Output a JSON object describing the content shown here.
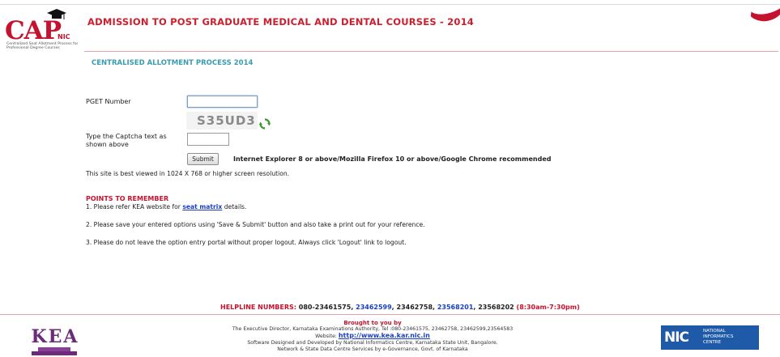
{
  "header": {
    "logo_text": "CAP",
    "logo_sub": "NIC",
    "logo_tagline": "Centralized Seat Allotment Process for Professional Degree Courses",
    "title": "ADMISSION TO POST GRADUATE MEDICAL AND DENTAL COURSES - 2014"
  },
  "main": {
    "subtitle": "CENTRALISED ALLOTMENT PROCESS 2014",
    "pget_label": "PGET Number",
    "pget_value": "",
    "captcha_text": "S35UD3",
    "captcha_label": "Type the Captcha text as shown above",
    "captcha_value": "",
    "submit_label": "Submit",
    "browser_note": "Internet Explorer 8 or above/Mozilla Firefox 10 or above/Google Chrome recommended",
    "resolution_note": "This site is best viewed in 1024 X 768 or higher screen resolution."
  },
  "points": {
    "heading": "POINTS TO REMEMBER",
    "p1_before": "1. Please refer KEA website for ",
    "p1_link": "seat matrix",
    "p1_after": " details.",
    "p2": "2. Please save your entered options using 'Save & Submit' button and also take a print out for your reference.",
    "p3": "3. Please do not leave the option entry portal without proper logout. Always click 'Logout' link to logout."
  },
  "helpline": {
    "label": "HELPLINE NUMBERS: ",
    "n1": "080-23461575, ",
    "n2": "23462599",
    "n3": ", 23462758, ",
    "n4": "23568201",
    "n5": ", 23568202 ",
    "hours": "(8:30am-7:30pm)"
  },
  "footer": {
    "kea_logo": "KEA",
    "brought": "Brought to you by",
    "line1": "The Executive Director, Karnataka Examinations Authority, Tel :080-23461575, 23462758, 23462599,23564583",
    "website_label": "Website: ",
    "website_link": "http://www.kea.kar.nic.in",
    "line2": "Software Designed and Developed by National Informatics Centre, Karnataka State Unit, Bangalore.",
    "line3": "Network & State Data Centre Services by e-Governance, Govt. of Karnataka",
    "nic_mark": "NIC",
    "nic_line1": "NATIONAL",
    "nic_line2": "INFORMATICS",
    "nic_line3": "CENTRE"
  },
  "colors": {
    "brand_red": "#c4122f",
    "subtitle_teal": "#3a9bb0",
    "link_blue": "#1a3fc4",
    "nic_blue": "#1f5aa8"
  }
}
